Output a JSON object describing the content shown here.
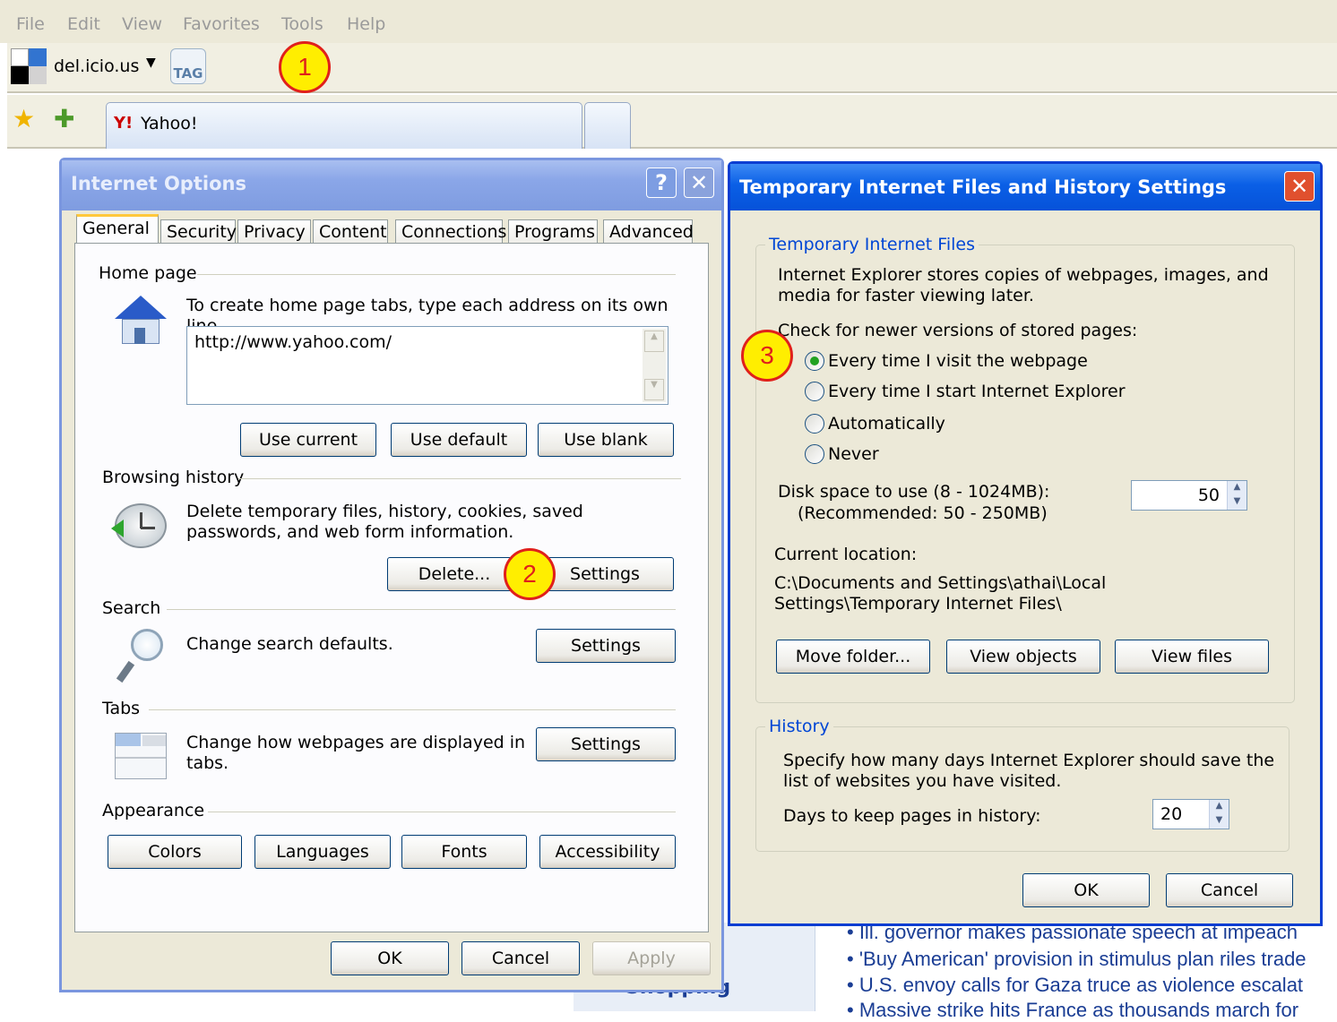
{
  "menu": [
    "File",
    "Edit",
    "View",
    "Favorites",
    "Tools",
    "Help"
  ],
  "links": {
    "delicious": "del.icio.us",
    "tag": "TAG"
  },
  "browser_tab": {
    "label": "Yahoo!"
  },
  "callouts": [
    "1",
    "2",
    "3"
  ],
  "internet_options": {
    "title": "Internet Options",
    "help_btn": "?",
    "close_btn": "✕",
    "tabs": [
      "General",
      "Security",
      "Privacy",
      "Content",
      "Connections",
      "Programs",
      "Advanced"
    ],
    "home_page": {
      "label": "Home page",
      "desc": "To create home page tabs, type each address on its own line.",
      "value": "http://www.yahoo.com/",
      "buttons": [
        "Use current",
        "Use default",
        "Use blank"
      ]
    },
    "browsing_history": {
      "label": "Browsing history",
      "desc": "Delete temporary files, history, cookies, saved passwords, and web form information.",
      "delete": "Delete...",
      "settings": "Settings"
    },
    "search": {
      "label": "Search",
      "desc": "Change search defaults.",
      "settings": "Settings"
    },
    "tabs_group": {
      "label": "Tabs",
      "desc": "Change how webpages are displayed in tabs.",
      "settings": "Settings"
    },
    "appearance": {
      "label": "Appearance",
      "buttons": [
        "Colors",
        "Languages",
        "Fonts",
        "Accessibility"
      ]
    },
    "ok": "OK",
    "cancel": "Cancel",
    "apply": "Apply"
  },
  "tif": {
    "title": "Temporary Internet Files and History Settings",
    "close_btn": "✕",
    "files": {
      "legend": "Temporary Internet Files",
      "desc": "Internet Explorer stores copies of webpages, images, and media for faster viewing later.",
      "check_label": "Check for newer versions of stored pages:",
      "options": [
        "Every time I visit the webpage",
        "Every time I start Internet Explorer",
        "Automatically",
        "Never"
      ],
      "selected": 0,
      "disk_label": "Disk space to use (8 - 1024MB):",
      "disk_rec": "(Recommended: 50 - 250MB)",
      "disk_value": "50",
      "location_label": "Current location:",
      "location_value": "C:\\Documents and Settings\\athai\\Local Settings\\Temporary Internet Files\\",
      "buttons": [
        "Move folder...",
        "View objects",
        "View files"
      ]
    },
    "history": {
      "legend": "History",
      "desc": "Specify how many days Internet Explorer should save the list of websites you have visited.",
      "days_label": "Days to keep pages in history:",
      "days_value": "20"
    },
    "ok": "OK",
    "cancel": "Cancel"
  },
  "background": {
    "sidebar_label": "Shopping",
    "news": [
      "• Ill. governor makes passionate speech at impeach",
      "• 'Buy American' provision in stimulus plan riles trade",
      "• U.S. envoy calls for Gaza truce as violence escalat",
      "• Massive strike hits France as thousands march for"
    ]
  }
}
